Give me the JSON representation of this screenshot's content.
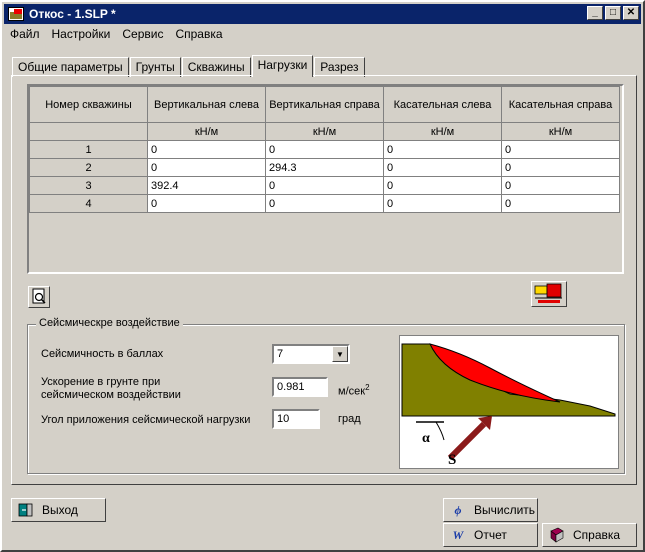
{
  "window": {
    "title": "Откос - 1.SLP *",
    "buttons": {
      "minimize": "_",
      "maximize": "□",
      "close": "✕"
    }
  },
  "menu": [
    "Файл",
    "Настройки",
    "Сервис",
    "Справка"
  ],
  "tabs": [
    {
      "label": "Общие параметры",
      "active": false
    },
    {
      "label": "Грунты",
      "active": false
    },
    {
      "label": "Скважины",
      "active": false
    },
    {
      "label": "Нагрузки",
      "active": true
    },
    {
      "label": "Разрез",
      "active": false
    }
  ],
  "loads_table": {
    "headers": [
      "Номер скважины",
      "Вертикальная слева",
      "Вертикальная справа",
      "Касательная слева",
      "Касательная справа"
    ],
    "units": [
      "",
      "кН/м",
      "кН/м",
      "кН/м",
      "кН/м"
    ],
    "rows": [
      {
        "num": "1",
        "values": [
          "0",
          "0",
          "0",
          "0"
        ]
      },
      {
        "num": "2",
        "values": [
          "0",
          "294.3",
          "0",
          "0"
        ]
      },
      {
        "num": "3",
        "values": [
          "392.4",
          "0",
          "0",
          "0"
        ]
      },
      {
        "num": "4",
        "values": [
          "0",
          "0",
          "0",
          "0"
        ]
      }
    ]
  },
  "seismic": {
    "group_title": "Сейсмическре воздействие",
    "intensity_label": "Сейсмичность в баллах",
    "intensity_value": "7",
    "accel_label_line1": "Ускорение в грунте при",
    "accel_label_line2": "сейсмическом воздействии",
    "accel_value": "0.981",
    "accel_unit": "м/сек",
    "accel_unit_sup": "2",
    "angle_label": "Угол приложения сейсмической нагрузки",
    "angle_value": "10",
    "angle_unit": "град",
    "diagram_alpha": "α",
    "diagram_s": "S"
  },
  "buttons": {
    "exit": "Выход",
    "calculate": "Вычислить",
    "report": "Отчет",
    "help": "Справка"
  },
  "colors": {
    "titlebar": "#0a246a",
    "soil": "#808000",
    "slide": "#ff0000",
    "arrow": "#8b1a1a"
  }
}
